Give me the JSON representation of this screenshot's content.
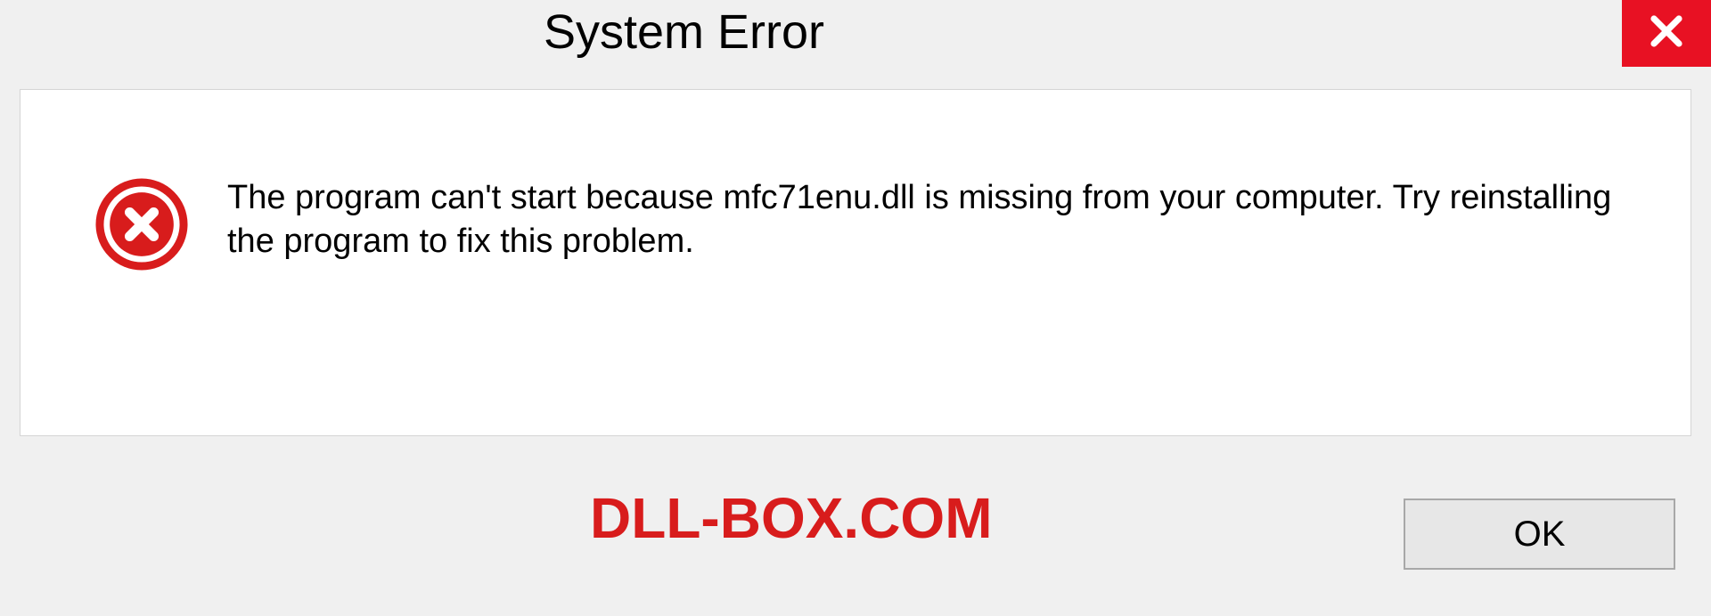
{
  "header": {
    "title": "System Error"
  },
  "body": {
    "message": "The program can't start because mfc71enu.dll is missing from your computer. Try reinstalling the program to fix this problem."
  },
  "footer": {
    "watermark": "DLL-BOX.COM",
    "ok_label": "OK"
  }
}
